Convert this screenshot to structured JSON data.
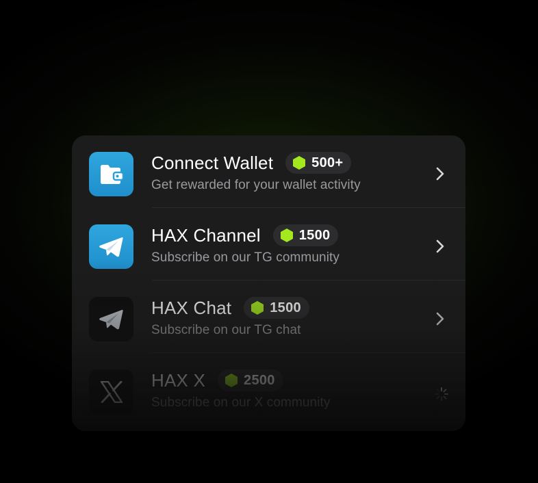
{
  "tasks": [
    {
      "title": "Connect Wallet",
      "reward": "500+",
      "subtitle": "Get rewarded for your wallet activity",
      "icon": "wallet-icon"
    },
    {
      "title": "HAX Channel",
      "reward": "1500",
      "subtitle": "Subscribe on our TG community",
      "icon": "telegram-icon"
    },
    {
      "title": "HAX Chat",
      "reward": "1500",
      "subtitle": "Subscribe on our TG chat",
      "icon": "telegram-icon"
    },
    {
      "title": "HAX X",
      "reward": "2500",
      "subtitle": "Subscribe on our X community",
      "icon": "x-logo-icon"
    }
  ],
  "colors": {
    "accent": "#a4e81f",
    "card_background": "#1c1c1d",
    "badge_background": "#2c2c2e",
    "telegram_blue": "#2aa0d9"
  }
}
